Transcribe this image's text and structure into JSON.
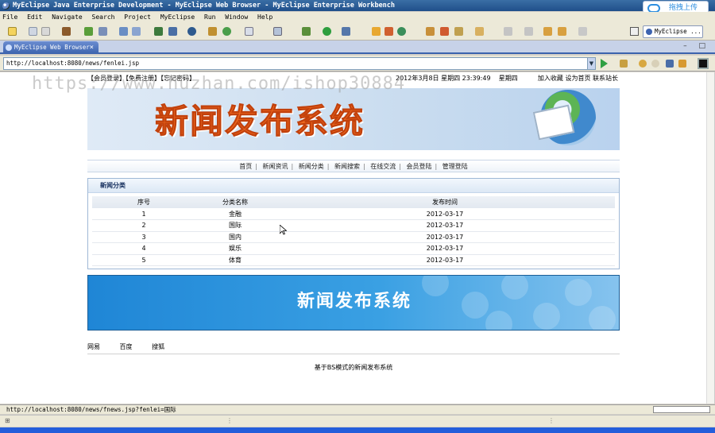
{
  "window": {
    "title": "MyEclipse Java Enterprise Development - MyEclipse Web Browser - MyEclipse Enterprise Workbench"
  },
  "cloud_button": {
    "label": "拖拽上传"
  },
  "menu": {
    "items": [
      "File",
      "Edit",
      "Navigate",
      "Search",
      "Project",
      "MyEclipse",
      "Run",
      "Window",
      "Help"
    ]
  },
  "toolbar": {
    "perspective_label": "MyEclipse ..."
  },
  "editor_tab": {
    "label": "MyEclipse Web Browser",
    "close": "×"
  },
  "address_bar": {
    "url": "http://localhost:8080/news/fenlei.jsp",
    "dropdown": "▼"
  },
  "page": {
    "top_links": "【会员登录】【免费注册】【忘记密码】",
    "date": "2012年3月8日 星期四 23:39:49",
    "weekday": "星期四",
    "right_links": "加入收藏 设为首页 联系站长",
    "banner_title": "新闻发布系统",
    "nav": [
      "首页",
      "新闻资讯",
      "新闻分类",
      "新闻搜索",
      "在线交流",
      "会员登陆",
      "管理登陆"
    ],
    "nav_sep": "|",
    "section_title": "新闻分类",
    "table": {
      "headers": [
        "序号",
        "分类名称",
        "发布时间"
      ],
      "rows": [
        [
          "1",
          "金融",
          "2012-03-17"
        ],
        [
          "2",
          "国际",
          "2012-03-17"
        ],
        [
          "3",
          "国内",
          "2012-03-17"
        ],
        [
          "4",
          "娱乐",
          "2012-03-17"
        ],
        [
          "5",
          "体育",
          "2012-03-17"
        ]
      ]
    },
    "footer_banner_title": "新闻发布系统",
    "friend_links": [
      "网易",
      "百度",
      "搜狐"
    ],
    "copyright": "基于BS模式的新闻发布系统"
  },
  "watermark": "https://www.huzhan.com/ishop30884",
  "status_bar": {
    "text": "http://localhost:8080/news/fnews.jsp?fenlei=国际"
  },
  "colors": {
    "title_bar": "#1f4f8a",
    "chrome": "#ece9d8",
    "banner_orange": "#f06a20",
    "footer_blue": "#1f86d6"
  }
}
